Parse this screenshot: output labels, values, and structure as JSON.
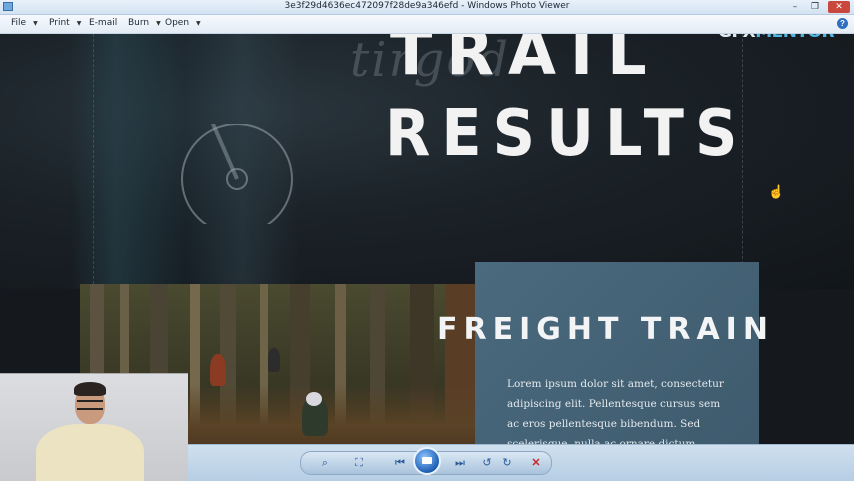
{
  "window": {
    "title": "3e3f29d4636ec472097f28de9a346efd - Windows Photo Viewer",
    "minimize_glyph": "–",
    "restore_glyph": "❐",
    "close_glyph": "✕"
  },
  "menu": {
    "items": [
      {
        "label": "File",
        "has_arrow": true
      },
      {
        "label": "Print",
        "has_arrow": true
      },
      {
        "label": "E-mail",
        "has_arrow": false
      },
      {
        "label": "Burn",
        "has_arrow": true
      },
      {
        "label": "Open",
        "has_arrow": true
      }
    ],
    "arrow_glyph": "▼",
    "help_glyph": "?"
  },
  "image_content": {
    "hero_title_top": "TRAIL",
    "hero_title": "RESULTS",
    "brand_part1": "GFX",
    "brand_part2": "MENTOR",
    "card_title": "FREIGHT TRAIN",
    "card_body": "Lorem ipsum dolor sit amet, consectetur adipiscing elit. Pellentesque cursus sem ac eros pellentesque bibendum. Sed scelerisque, nulla ac ornare dictum"
  },
  "toolbar": {
    "zoom_glyph": "⌕",
    "actual_size_glyph": "⛶",
    "previous_glyph": "⏮",
    "next_glyph": "⏭",
    "rotate_ccw_glyph": "↺",
    "rotate_cw_glyph": "↻",
    "delete_glyph": "✕"
  },
  "colors": {
    "brand_accent": "#4fb6e0",
    "card_bg": "#45627a",
    "delete_red": "#c8282a"
  }
}
